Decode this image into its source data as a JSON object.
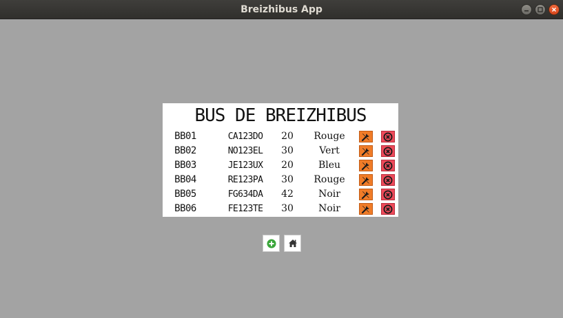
{
  "window": {
    "title": "Breizhibus App",
    "controls": {
      "minimize_icon": "minimize-icon",
      "maximize_icon": "maximize-icon",
      "close_icon": "close-icon"
    }
  },
  "main": {
    "heading": "BUS DE BREIZHIBUS",
    "buses": [
      {
        "id": "BB01",
        "plate": "CA123DO",
        "seats": "20",
        "color": "Rouge"
      },
      {
        "id": "BB02",
        "plate": "NO123EL",
        "seats": "30",
        "color": "Vert"
      },
      {
        "id": "BB03",
        "plate": "JE123UX",
        "seats": "20",
        "color": "Bleu"
      },
      {
        "id": "BB04",
        "plate": "RE123PA",
        "seats": "30",
        "color": "Rouge"
      },
      {
        "id": "BB05",
        "plate": "FG634DA",
        "seats": "42",
        "color": "Noir"
      },
      {
        "id": "BB06",
        "plate": "FE123TE",
        "seats": "30",
        "color": "Noir"
      }
    ],
    "row_actions": {
      "edit_icon": "wrench-icon",
      "delete_icon": "delete-icon"
    }
  },
  "footer": {
    "add_icon": "add-circle-icon",
    "home_icon": "home-icon"
  },
  "colors": {
    "background": "#a3a3a3",
    "titlebar": "#3a3936",
    "edit_button": "#f07c28",
    "delete_button": "#ee4a5a",
    "add_icon": "#3aa63a"
  }
}
